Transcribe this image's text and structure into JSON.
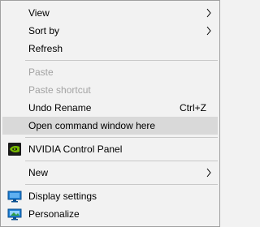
{
  "context_menu": {
    "items": [
      {
        "label": "View",
        "has_submenu": true
      },
      {
        "label": "Sort by",
        "has_submenu": true
      },
      {
        "label": "Refresh"
      },
      {
        "label": "Paste",
        "disabled": true
      },
      {
        "label": "Paste shortcut",
        "disabled": true
      },
      {
        "label": "Undo Rename",
        "shortcut": "Ctrl+Z"
      },
      {
        "label": "Open command window here",
        "highlighted": true
      },
      {
        "label": "NVIDIA Control Panel",
        "icon": "nvidia-icon"
      },
      {
        "label": "New",
        "has_submenu": true
      },
      {
        "label": "Display settings",
        "icon": "display-settings-icon"
      },
      {
        "label": "Personalize",
        "icon": "personalize-icon"
      }
    ]
  },
  "colors": {
    "menu_background": "#f2f2f2",
    "highlight": "#d9d9d9",
    "disabled_text": "#a3a3a3",
    "nvidia_green": "#76b900"
  }
}
